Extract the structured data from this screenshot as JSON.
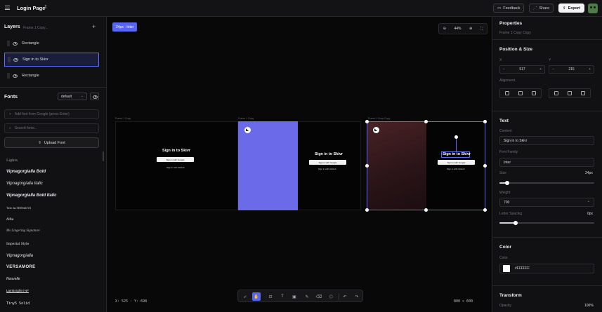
{
  "header": {
    "title": "Login Page",
    "feedback_label": "Feedback",
    "share_label": "Share",
    "export_label": "Export"
  },
  "layers": {
    "title": "Layers",
    "subtitle": "Frame 1 Copy...",
    "items": [
      {
        "label": "Rectangle",
        "selected": false
      },
      {
        "label": "Sign in to Skivr",
        "selected": true
      },
      {
        "label": "Rectangle",
        "selected": false
      }
    ]
  },
  "fonts": {
    "title": "Fonts",
    "select_value": "default",
    "add_placeholder": "Add font from Google (press Enter)",
    "search_placeholder": "Search fonts...",
    "upload_label": "Upload Font",
    "list": [
      "Lights",
      "Vipnagorgialla Bold",
      "Vipnagorgialla Italic",
      "Vipnagorgialla Bold Italic",
      "Tele ALTERNATIS",
      "Alfie",
      "Ms Lingering Signature",
      "Imperial Style",
      "Vipnagorgialla",
      "VERSAMORE",
      "Nouvelle",
      "Lamborghini NF",
      "Tiny5 Solid"
    ]
  },
  "canvas": {
    "badge": "24px · Inter",
    "zoom": "44%",
    "cursor_readout": "X: 525 · Y: 698",
    "canvas_size": "800 × 600",
    "frame_labels": [
      "Frame 1 Copy",
      "Frame 1 Copy",
      "Frame 1 Copy Copy"
    ],
    "mock": {
      "heading": "Sign in to Skivr",
      "google": "Sign in with Google",
      "github": "Sign in with GitHub"
    }
  },
  "properties": {
    "title": "Properties",
    "subtitle": "Frame 1 Copy Copy",
    "position_title": "Position & Size",
    "x_label": "X",
    "x_value": "517",
    "y_label": "Y",
    "y_value": "215",
    "alignment_label": "Alignment",
    "text_title": "Text",
    "content_label": "Content",
    "content_value": "Sign in to Skivr",
    "font_family_label": "Font Family",
    "font_family_value": "Inter",
    "size_label": "Size",
    "size_value": "24px",
    "size_fraction": 0.08,
    "weight_label": "Weight",
    "weight_value": "700",
    "letter_spacing_label": "Letter Spacing",
    "letter_spacing_value": "0px",
    "letter_spacing_fraction": 0.17,
    "color_title": "Color",
    "color_label": "Color",
    "color_value": "#FFFFFF",
    "transform_title": "Transform",
    "opacity_label": "Opacity",
    "opacity_value": "100%"
  },
  "colors": {
    "accent": "#5865f2",
    "selection": "#5d6bff",
    "frame_purple": "#6b6ae8"
  }
}
